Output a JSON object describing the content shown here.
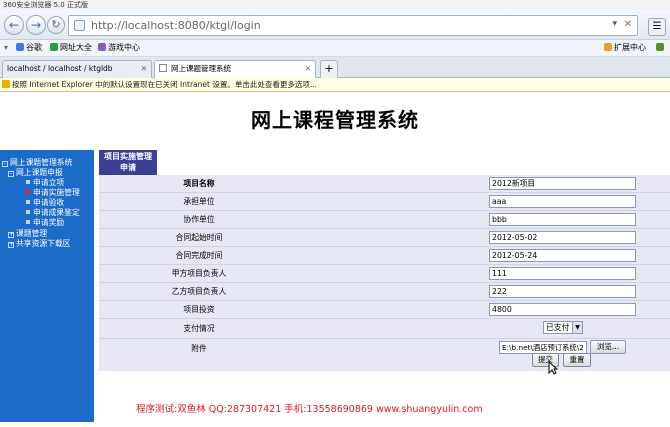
{
  "browser": {
    "title": "360安全浏览器 5.0 正式版",
    "url": "http://localhost:8080/ktgl/login"
  },
  "favorites": [
    {
      "label": "谷歌",
      "icon": "google-icon",
      "color": "#3b7ddd"
    },
    {
      "label": "网址大全",
      "icon": "globe-icon",
      "color": "#2a9d46"
    },
    {
      "label": "游戏中心",
      "icon": "game-icon",
      "color": "#8a5cc6"
    }
  ],
  "favorites_right": "扩展中心",
  "tabs": [
    {
      "label": "localhost / localhost / ktgldb"
    },
    {
      "label": "网上课题管理系统"
    }
  ],
  "infobar": "按照 Internet Explorer 中的默认设置现在已关闭 Intranet 设置。单击此处查看更多选项...",
  "page": {
    "title": "网上课程管理系统",
    "form_header_line1": "项目实施管理",
    "form_header_line2": "申请"
  },
  "sidebar": {
    "items": [
      {
        "label": "网上课题管理系统"
      },
      {
        "label": "网上课题申报"
      },
      {
        "label": "申请立项"
      },
      {
        "label": "申请实施管理"
      },
      {
        "label": "申请验收"
      },
      {
        "label": "申请成果鉴定"
      },
      {
        "label": "申请奖励"
      },
      {
        "label": "课题管理"
      },
      {
        "label": "共享资源下载区"
      }
    ]
  },
  "form": {
    "rows": [
      {
        "label": "项目名称",
        "value": "2012新项目"
      },
      {
        "label": "承担单位",
        "value": "aaa"
      },
      {
        "label": "协作单位",
        "value": "bbb"
      },
      {
        "label": "合同起始时间",
        "value": "2012-05-02"
      },
      {
        "label": "合同完成时间",
        "value": "2012-05-24"
      },
      {
        "label": "甲方项目负责人",
        "value": "111"
      },
      {
        "label": "乙方项目负责人",
        "value": "222"
      },
      {
        "label": "项目投资",
        "value": "4800"
      }
    ],
    "payment_label": "支付情况",
    "payment_value": "已支付",
    "attachment_label": "附件",
    "attachment_value": "E:\\b.net\\酒店预订系统\\2",
    "browse_label": "浏览...",
    "submit_label": "提交",
    "reset_label": "重置"
  },
  "footer": "程序测试:双鱼林 QQ:287307421 手机:13558690869 www.shuangyulin.com"
}
